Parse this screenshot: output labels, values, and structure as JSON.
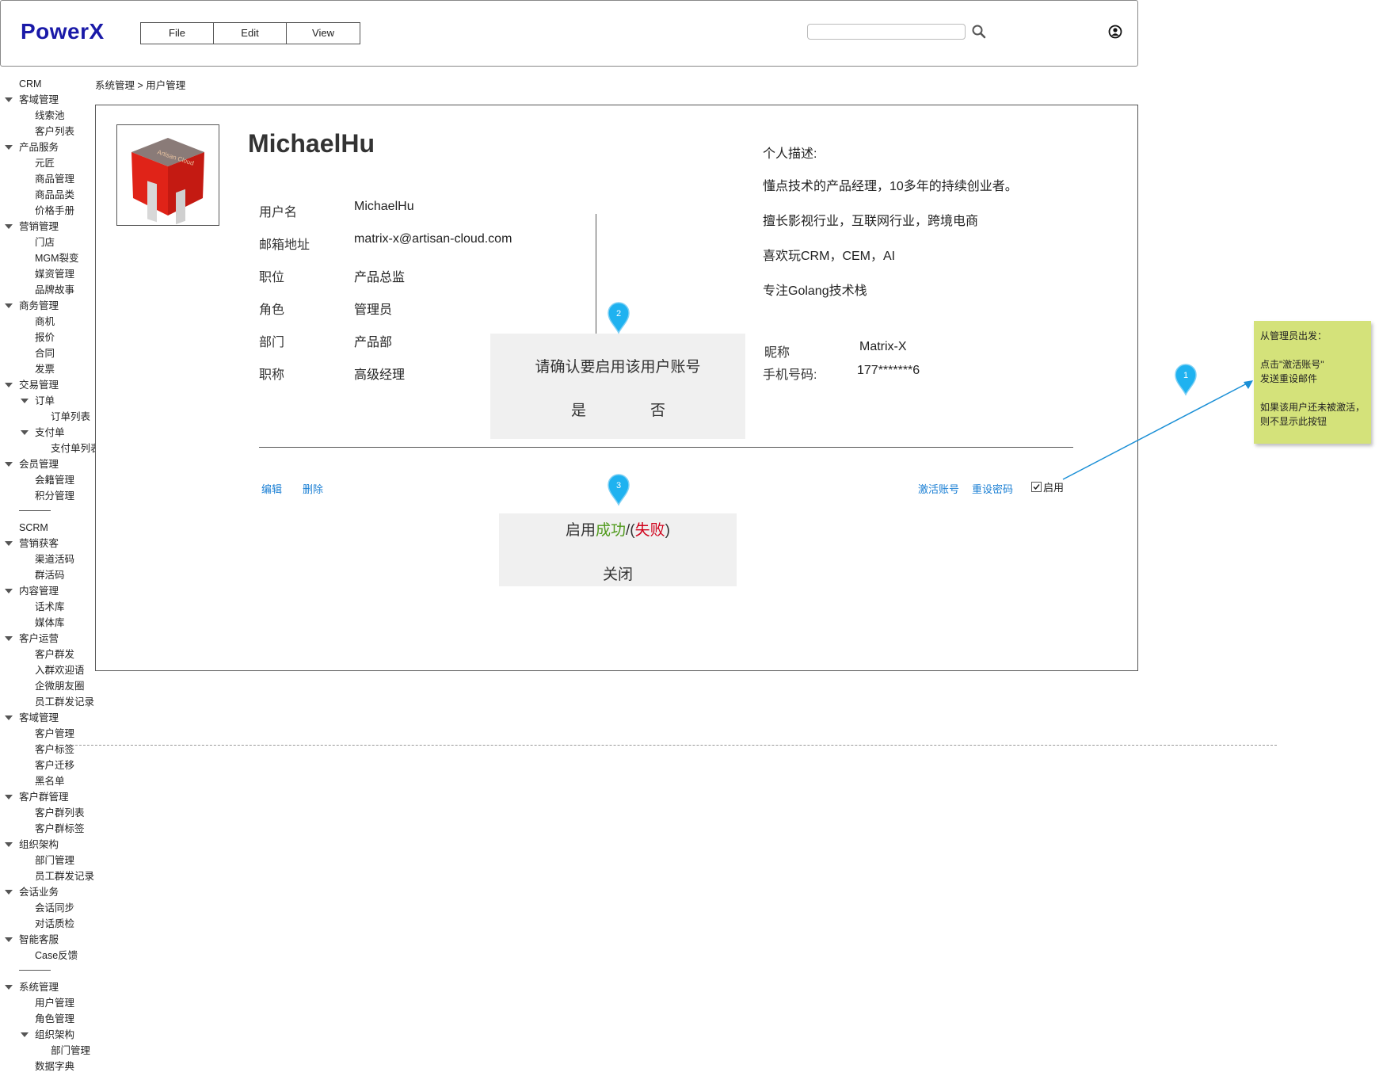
{
  "header": {
    "logo": "PowerX",
    "menu": [
      "File",
      "Edit",
      "View"
    ],
    "search_placeholder": ""
  },
  "sidebar": {
    "rows": [
      {
        "label": "CRM",
        "level": 0,
        "caret": false
      },
      {
        "label": "客域管理",
        "level": 0,
        "caret": true
      },
      {
        "label": "线索池",
        "level": 1,
        "caret": false
      },
      {
        "label": "客户列表",
        "level": 1,
        "caret": false
      },
      {
        "label": "产品服务",
        "level": 0,
        "caret": true
      },
      {
        "label": "元匠",
        "level": 1,
        "caret": false
      },
      {
        "label": "商品管理",
        "level": 1,
        "caret": false
      },
      {
        "label": "商品品类",
        "level": 1,
        "caret": false
      },
      {
        "label": "价格手册",
        "level": 1,
        "caret": false
      },
      {
        "label": "营销管理",
        "level": 0,
        "caret": true
      },
      {
        "label": "门店",
        "level": 1,
        "caret": false
      },
      {
        "label": "MGM裂变",
        "level": 1,
        "caret": false
      },
      {
        "label": "媒资管理",
        "level": 1,
        "caret": false
      },
      {
        "label": "品牌故事",
        "level": 1,
        "caret": false
      },
      {
        "label": "商务管理",
        "level": 0,
        "caret": true
      },
      {
        "label": "商机",
        "level": 1,
        "caret": false
      },
      {
        "label": "报价",
        "level": 1,
        "caret": false
      },
      {
        "label": "合同",
        "level": 1,
        "caret": false
      },
      {
        "label": "发票",
        "level": 1,
        "caret": false
      },
      {
        "label": "交易管理",
        "level": 0,
        "caret": true
      },
      {
        "label": "订单",
        "level": 1,
        "caret": true
      },
      {
        "label": "订单列表",
        "level": 2,
        "caret": false
      },
      {
        "label": "支付单",
        "level": 1,
        "caret": true
      },
      {
        "label": "支付单列表",
        "level": 2,
        "caret": false
      },
      {
        "label": "会员管理",
        "level": 0,
        "caret": true
      },
      {
        "label": "会籍管理",
        "level": 1,
        "caret": false
      },
      {
        "label": "积分管理",
        "level": 1,
        "caret": false
      },
      {
        "label": "",
        "level": 0,
        "caret": false,
        "separator": true
      },
      {
        "label": "SCRM",
        "level": 0,
        "caret": false
      },
      {
        "label": "营销获客",
        "level": 0,
        "caret": true
      },
      {
        "label": "渠道活码",
        "level": 1,
        "caret": false
      },
      {
        "label": "群活码",
        "level": 1,
        "caret": false
      },
      {
        "label": "内容管理",
        "level": 0,
        "caret": true
      },
      {
        "label": "话术库",
        "level": 1,
        "caret": false
      },
      {
        "label": "媒体库",
        "level": 1,
        "caret": false
      },
      {
        "label": "客户运营",
        "level": 0,
        "caret": true
      },
      {
        "label": "客户群发",
        "level": 1,
        "caret": false
      },
      {
        "label": "入群欢迎语",
        "level": 1,
        "caret": false
      },
      {
        "label": "企微朋友圈",
        "level": 1,
        "caret": false
      },
      {
        "label": "员工群发记录",
        "level": 1,
        "caret": false
      },
      {
        "label": "客域管理",
        "level": 0,
        "caret": true
      },
      {
        "label": "客户管理",
        "level": 1,
        "caret": false
      },
      {
        "label": "客户标签",
        "level": 1,
        "caret": false
      },
      {
        "label": "客户迁移",
        "level": 1,
        "caret": false
      },
      {
        "label": "黑名单",
        "level": 1,
        "caret": false
      },
      {
        "label": "客户群管理",
        "level": 0,
        "caret": true
      },
      {
        "label": "客户群列表",
        "level": 1,
        "caret": false
      },
      {
        "label": "客户群标签",
        "level": 1,
        "caret": false
      },
      {
        "label": "组织架构",
        "level": 0,
        "caret": true
      },
      {
        "label": "部门管理",
        "level": 1,
        "caret": false
      },
      {
        "label": "员工群发记录",
        "level": 1,
        "caret": false
      },
      {
        "label": "会话业务",
        "level": 0,
        "caret": true
      },
      {
        "label": "会话同步",
        "level": 1,
        "caret": false
      },
      {
        "label": "对话质检",
        "level": 1,
        "caret": false
      },
      {
        "label": "智能客服",
        "level": 0,
        "caret": true
      },
      {
        "label": "Case反馈",
        "level": 1,
        "caret": false
      },
      {
        "label": "",
        "level": 0,
        "caret": false,
        "separator": true
      },
      {
        "label": "系统管理",
        "level": 0,
        "caret": true
      },
      {
        "label": "用户管理",
        "level": 1,
        "caret": false
      },
      {
        "label": "角色管理",
        "level": 1,
        "caret": false
      },
      {
        "label": "组织架构",
        "level": 1,
        "caret": true
      },
      {
        "label": "部门管理",
        "level": 2,
        "caret": false
      },
      {
        "label": "数据字典",
        "level": 1,
        "caret": false
      }
    ]
  },
  "breadcrumb": "系统管理 > 用户管理",
  "profile": {
    "name": "MichaelHu",
    "avatar_caption": "Artisan Cloud",
    "fields": [
      {
        "label": "用户名",
        "value": "MichaelHu"
      },
      {
        "label": "邮箱地址",
        "value": "matrix-x@artisan-cloud.com"
      },
      {
        "label": "职位",
        "value": "产品总监"
      },
      {
        "label": "角色",
        "value": "管理员"
      },
      {
        "label": "部门",
        "value": "产品部"
      },
      {
        "label": "职称",
        "value": "高级经理"
      }
    ],
    "description_title": "个人描述:",
    "description_lines": [
      "懂点技术的产品经理，10多年的持续创业者。",
      "擅长影视行业，互联网行业，跨境电商",
      "喜欢玩CRM，CEM，AI",
      "专注Golang技术栈"
    ],
    "nickname_label": "昵称",
    "nickname_value": "Matrix-X",
    "phone_label": "手机号码:",
    "phone_value": "177*******6"
  },
  "actions": {
    "edit": "编辑",
    "delete": "删除",
    "activate": "激活账号",
    "reset_password": "重设密码",
    "enable_label": "启用",
    "enable_checked": true
  },
  "confirm_dialog": {
    "message": "请确认要启用该用户账号",
    "yes": "是",
    "no": "否"
  },
  "result_dialog": {
    "prefix": "启用",
    "success": "成功",
    "sep_open": "/(",
    "fail": "失败",
    "sep_close": ")",
    "close": "关闭"
  },
  "pins": [
    "1",
    "2",
    "3"
  ],
  "note": {
    "line1": "从管理员出发：",
    "line2": "点击\"激活账号\"",
    "line3": "发送重设邮件",
    "line4": "如果该用户还未被激活，则不显示此按钮"
  },
  "colors": {
    "logo": "#1a1aa8",
    "link": "#1a7fd4",
    "success": "#4f9a1b",
    "fail": "#d0021b",
    "pin": "#1fb2f0",
    "note": "#d4e27a"
  }
}
